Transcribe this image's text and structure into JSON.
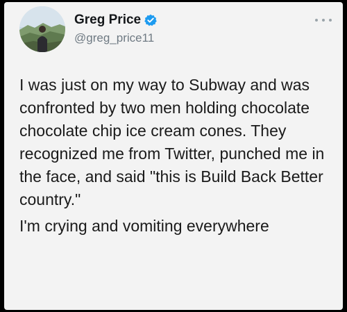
{
  "author": {
    "name": "Greg Price",
    "handle": "@greg_price11",
    "verified": true,
    "avatar": "profile-photo"
  },
  "menu_icon": "more-options-icon",
  "colors": {
    "card_background": "#f3f3f3",
    "verified_badge": "#1d9bf0",
    "handle_text": "#6f7a83",
    "body_text": "#1a1a1a",
    "frame": "#000000"
  },
  "tweet": {
    "paragraphs": [
      "I was just on my way to Subway and was confronted by two men holding chocolate chocolate chip ice cream cones. They recognized me from Twitter, punched me in the face, and said \"this is Build Back Better country.\"",
      "I'm crying and vomiting everywhere"
    ]
  }
}
